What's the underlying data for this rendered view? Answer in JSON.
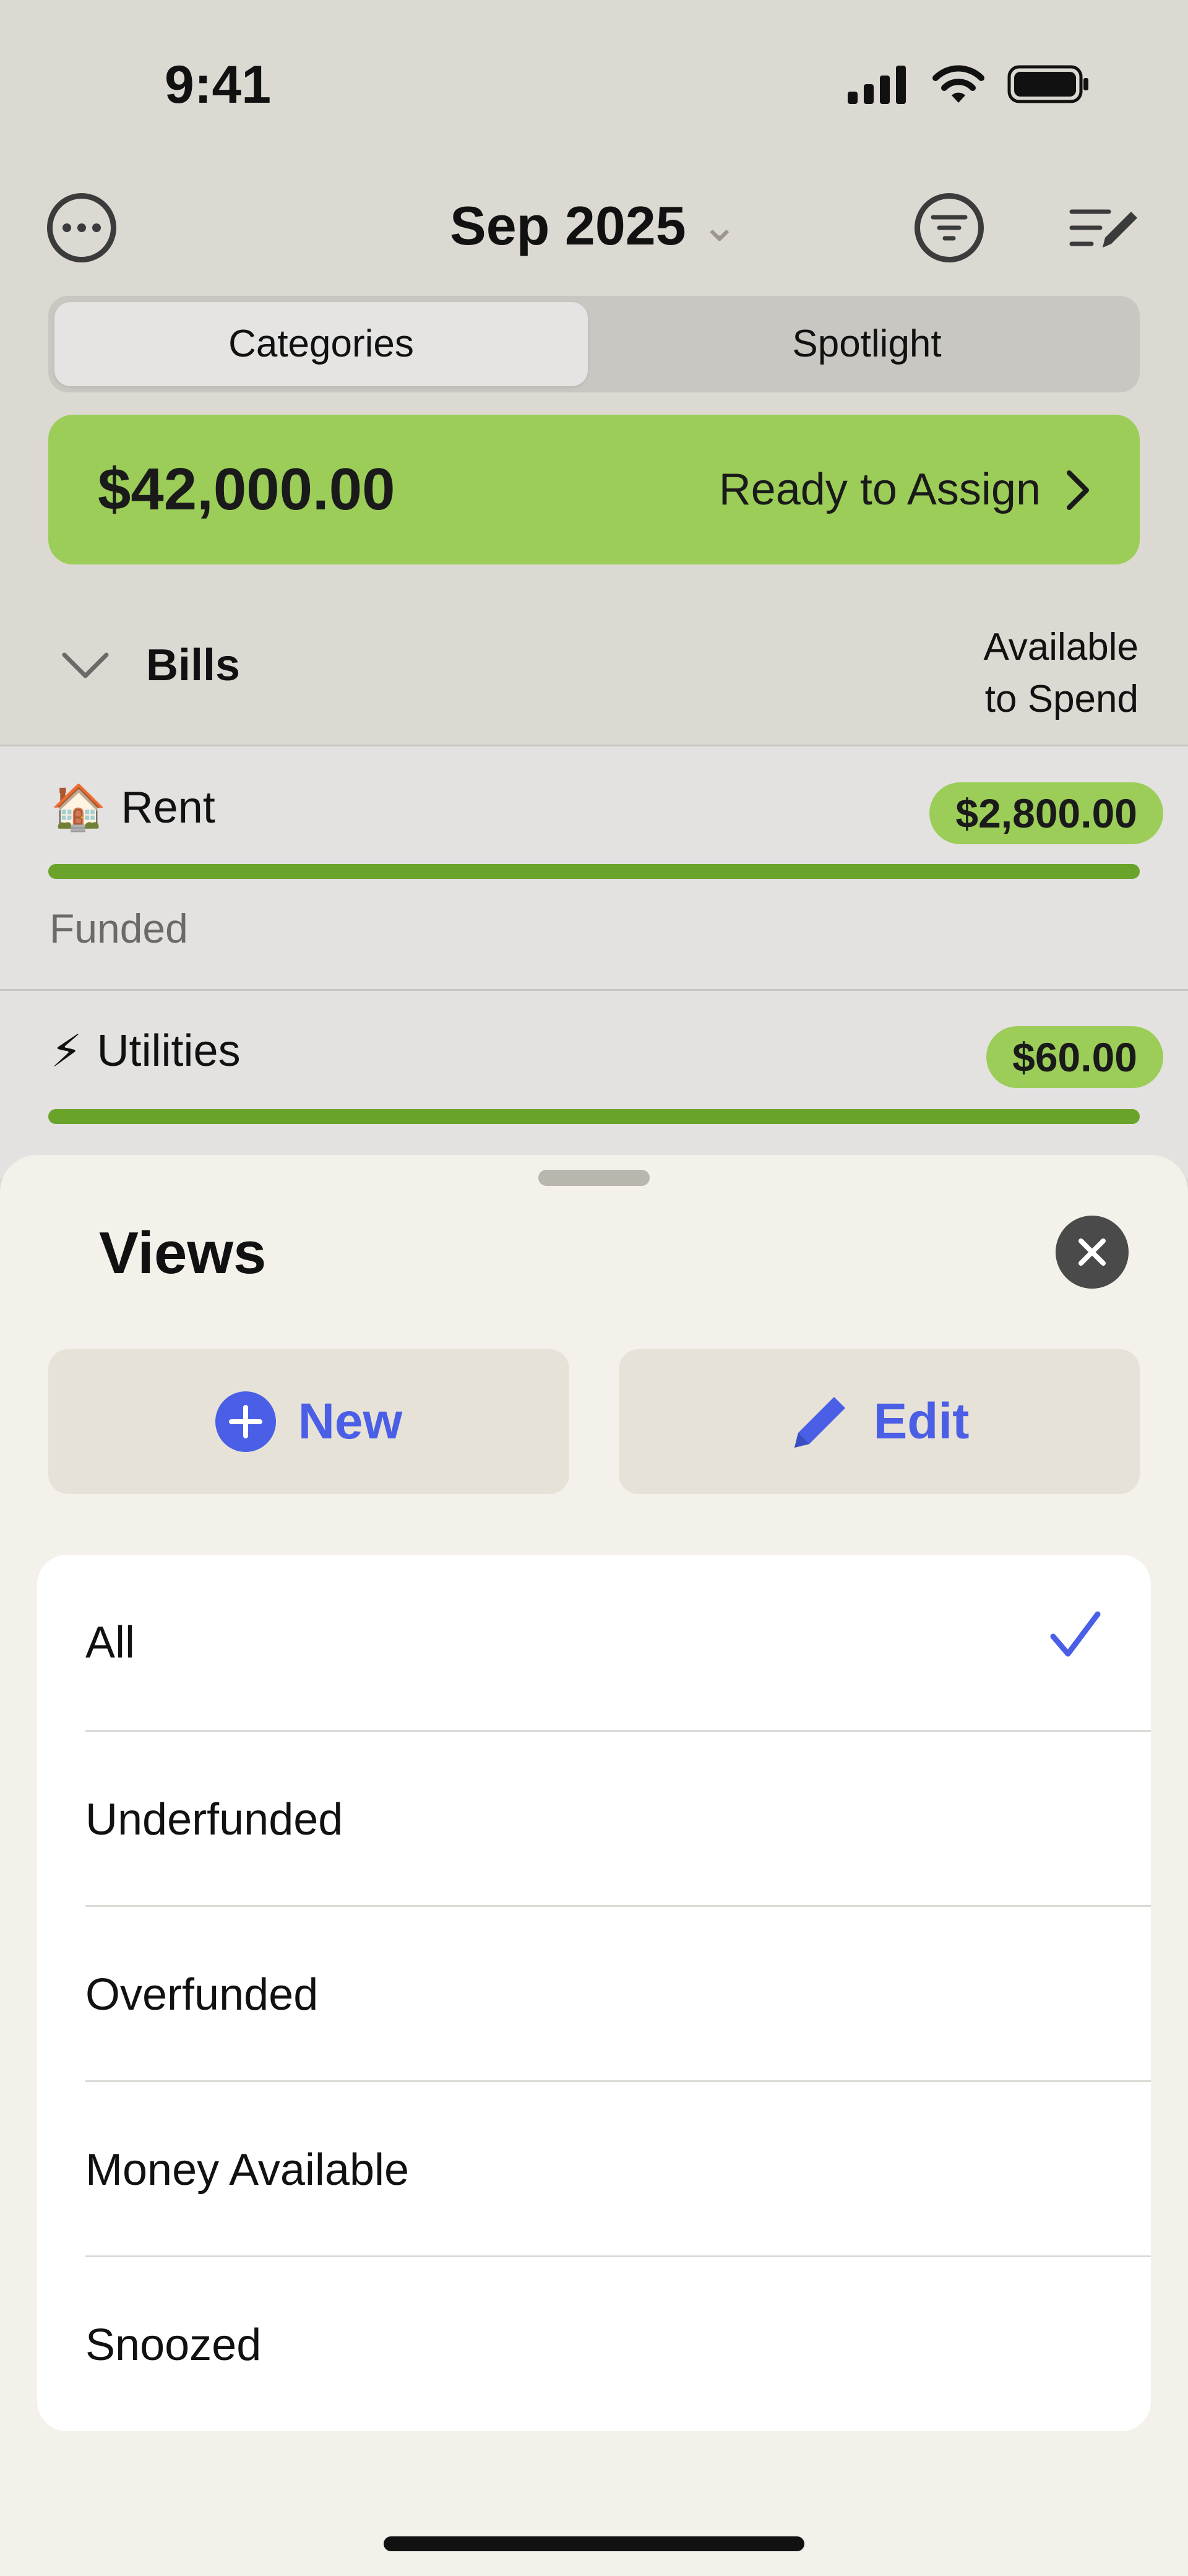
{
  "status_bar": {
    "time": "9:41"
  },
  "header": {
    "month": "Sep 2025",
    "more_icon": "ellipsis-circle-icon",
    "filter_icon": "filter-circle-icon",
    "edit_icon": "list-edit-icon"
  },
  "segmented": {
    "tabs": [
      "Categories",
      "Spotlight"
    ],
    "selected": "Categories"
  },
  "ready_to_assign": {
    "amount": "$42,000.00",
    "label": "Ready to Assign"
  },
  "group": {
    "name": "Bills",
    "column_line1": "Available",
    "column_line2": "to Spend"
  },
  "categories": [
    {
      "emoji": "🏠",
      "name": "Rent",
      "amount": "$2,800.00",
      "status": "Funded",
      "progress": 1.0
    },
    {
      "emoji": "⚡",
      "name": "Utilities",
      "amount": "$60.00",
      "progress": 1.0
    }
  ],
  "sheet": {
    "title": "Views",
    "new_label": "New",
    "edit_label": "Edit",
    "views": [
      "All",
      "Underfunded",
      "Overfunded",
      "Money Available",
      "Snoozed"
    ],
    "selected_view": "All"
  },
  "colors": {
    "accent": "#4a5ee6",
    "positive": "#9bcd58",
    "progress": "#6aa32a"
  }
}
